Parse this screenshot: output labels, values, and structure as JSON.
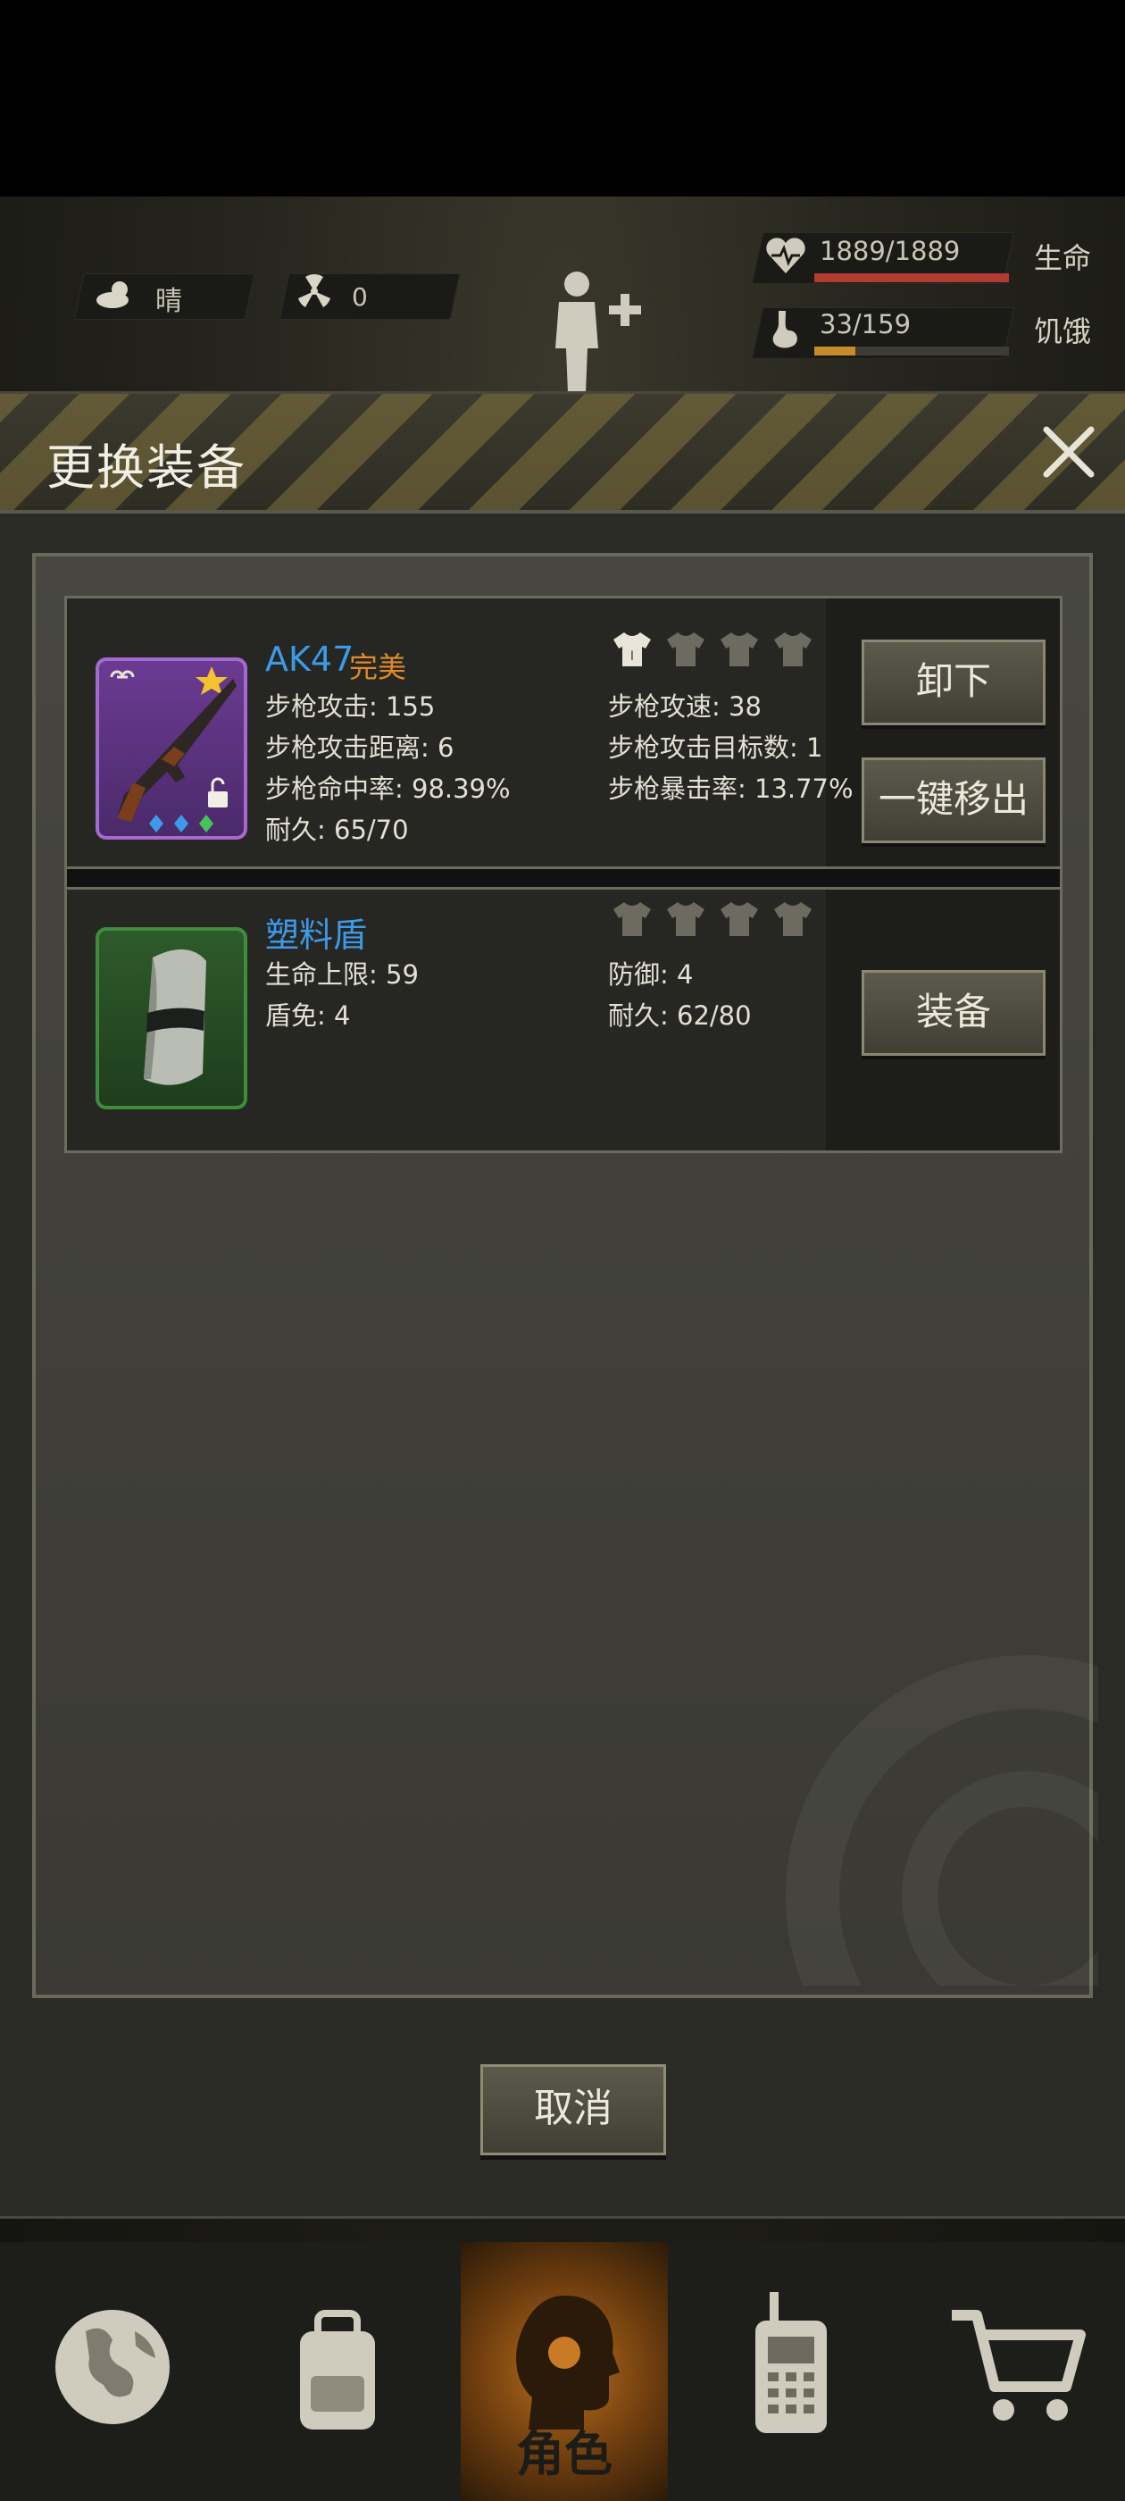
{
  "hud": {
    "weather": "晴",
    "radiation": "0",
    "health": {
      "value": "1889/1889",
      "label": "生命",
      "fill": 1.0,
      "color": "#b33a30"
    },
    "hunger": {
      "value": "33/159",
      "label": "饥饿",
      "fill": 0.21,
      "color": "#c68b2a"
    }
  },
  "modal": {
    "title": "更换装备",
    "cancel_label": "取消",
    "items": [
      {
        "name": "AK47",
        "quality": "完美",
        "attrs_left": [
          "步枪攻击: 155",
          "步枪攻击距离: 6",
          "步枪命中率: 98.39%",
          "耐久: 65/70"
        ],
        "attrs_right": [
          "步枪攻速: 38",
          "步枪攻击目标数: 1",
          "步枪暴击率: 13.77%"
        ],
        "buttons": [
          "卸下",
          "一键移出"
        ]
      },
      {
        "name": "塑料盾",
        "attrs_left": [
          "生命上限: 59",
          "盾免: 4"
        ],
        "attrs_right": [
          "防御: 4",
          "耐久: 62/80"
        ],
        "buttons": [
          "装备"
        ]
      }
    ]
  },
  "nav": {
    "active_label": "角色",
    "items": [
      "world-map-icon",
      "backpack-icon",
      "character-icon",
      "walkie-talkie-icon",
      "shopping-cart-icon"
    ]
  }
}
